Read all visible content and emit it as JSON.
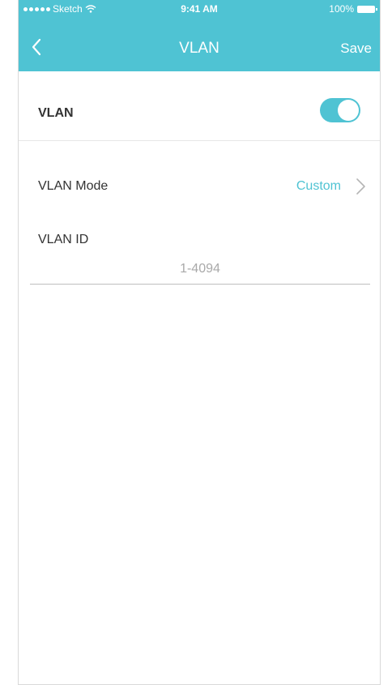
{
  "status_bar": {
    "carrier": "Sketch",
    "time": "9:41 AM",
    "battery": "100%"
  },
  "nav": {
    "title": "VLAN",
    "save_label": "Save",
    "back_icon": "chevron-left-icon"
  },
  "vlan_toggle": {
    "label": "VLAN",
    "enabled": true
  },
  "vlan_mode": {
    "label": "VLAN Mode",
    "value": "Custom"
  },
  "vlan_id": {
    "label": "VLAN ID",
    "placeholder": "1-4094",
    "value": ""
  },
  "colors": {
    "accent": "#4fc3d3",
    "text": "#333333",
    "placeholder": "#a9a9a9"
  }
}
